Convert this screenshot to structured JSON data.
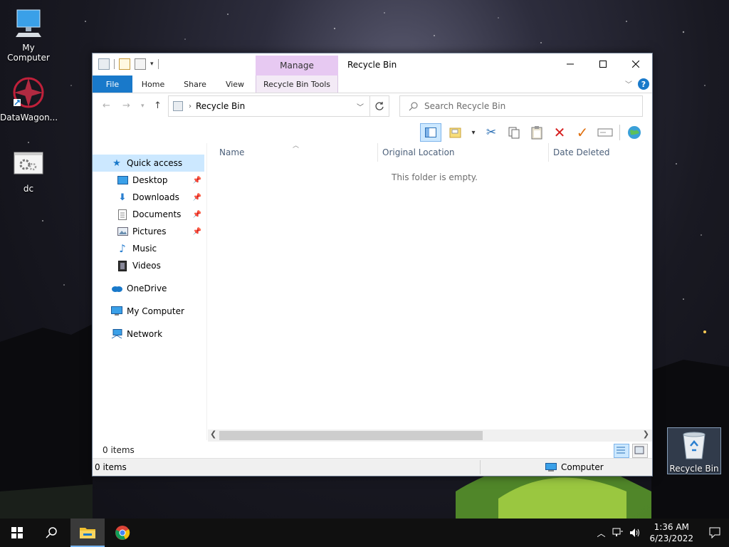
{
  "desktop": {
    "icons": [
      {
        "label": "My Computer",
        "icon": "monitor-icon"
      },
      {
        "label": "DataWagon...",
        "icon": "datawagon-icon"
      },
      {
        "label": "dc",
        "icon": "gears-icon"
      },
      {
        "label": "Recycle Bin",
        "icon": "recycle-bin-icon"
      }
    ]
  },
  "window": {
    "title": "Recycle Bin",
    "contextual_group": "Manage",
    "minimize": "–",
    "maximize": "☐",
    "close": "✕",
    "ribbon_tabs": [
      "File",
      "Home",
      "Share",
      "View",
      "Recycle Bin Tools"
    ],
    "help": "?",
    "address": {
      "path": "Recycle Bin"
    },
    "search": {
      "placeholder": "Search Recycle Bin"
    },
    "nav": {
      "quick_access": "Quick access",
      "items": [
        {
          "label": "Desktop",
          "pinned": true
        },
        {
          "label": "Downloads",
          "pinned": true
        },
        {
          "label": "Documents",
          "pinned": true
        },
        {
          "label": "Pictures",
          "pinned": true
        },
        {
          "label": "Music",
          "pinned": false
        },
        {
          "label": "Videos",
          "pinned": false
        }
      ],
      "onedrive": "OneDrive",
      "this_pc": "My Computer",
      "network": "Network"
    },
    "columns": [
      "Name",
      "Original Location",
      "Date Deleted"
    ],
    "empty_message": "This folder is empty.",
    "status_items": "0 items",
    "bottom_bar": {
      "left": "0 items",
      "right": "Computer"
    }
  },
  "taskbar": {
    "time": "1:36 AM",
    "date": "6/23/2022"
  },
  "colors": {
    "accent": "#1979ca",
    "manage_tab": "#e7c9f2",
    "selection": "#cce8ff"
  }
}
